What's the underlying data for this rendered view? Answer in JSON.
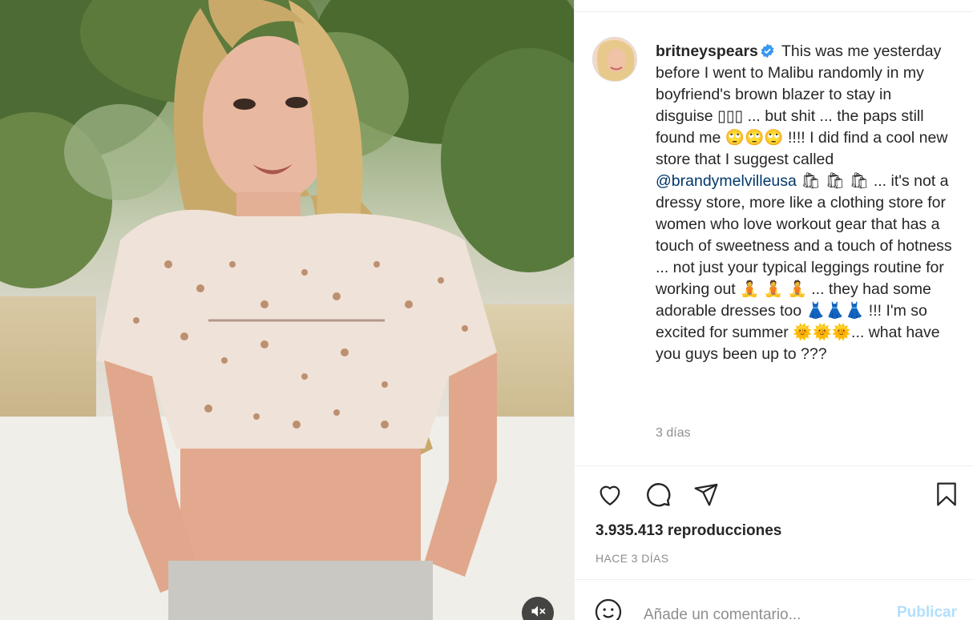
{
  "post": {
    "username": "britneyspears",
    "verified_icon": "verified-badge-icon",
    "caption_parts": {
      "p1": "This was me yesterday before I went to Malibu randomly in my boyfriend's brown blazer to stay in disguise ▯▯▯ ... but shit ... the paps still found me 🙄🙄🙄 !!!! I did find a cool new store that I suggest called ",
      "mention": "@brandymelvilleusa",
      "p2": " 🛍 🛍 🛍 ... it's not a dressy store, more like a clothing store for women who love workout gear that has a touch of sweetness and a touch of hotness ... not just your typical leggings routine for working out 🧘 🧘 🧘 ... they had some adorable dresses too 👗👗👗 !!! I'm so excited for summer 🌞🌞🌞... what have you guys been up to ???"
    },
    "caption_time": "3 días",
    "views_count": "3.935.413",
    "views_label": "reproducciones",
    "date_caps": "HACE 3 DÍAS"
  },
  "actions": {
    "like_icon": "heart-icon",
    "comment_icon": "comment-icon",
    "share_icon": "share-icon",
    "save_icon": "bookmark-icon"
  },
  "comment_box": {
    "placeholder": "Añade un comentario...",
    "post_label": "Publicar"
  },
  "media": {
    "mute_icon": "volume-off-icon"
  },
  "colors": {
    "link": "#00376b",
    "verified": "#3897f0",
    "muted_text": "#8e8e8e",
    "publish_disabled": "#b2dffc"
  }
}
